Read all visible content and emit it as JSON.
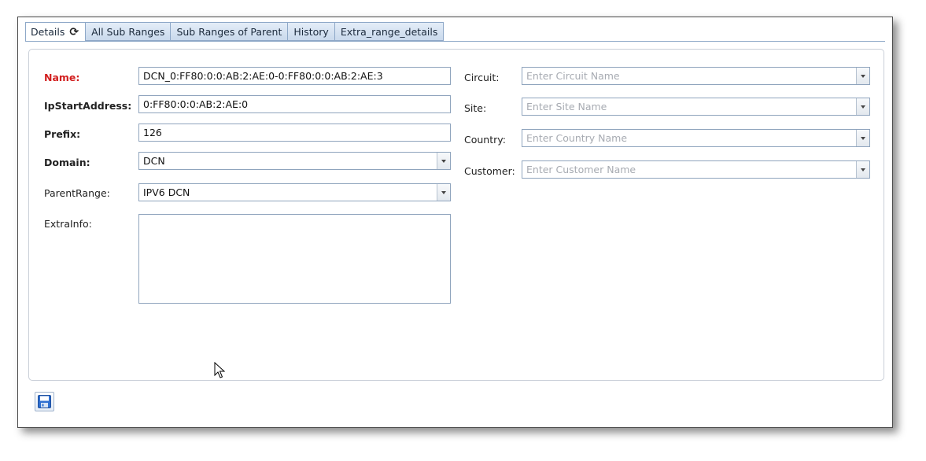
{
  "tabs": [
    {
      "label": "Details",
      "active": true,
      "icon": "refresh-icon"
    },
    {
      "label": "All Sub Ranges"
    },
    {
      "label": "Sub Ranges of Parent"
    },
    {
      "label": "History"
    },
    {
      "label": "Extra_range_details"
    }
  ],
  "form": {
    "name": {
      "label": "Name:",
      "value": "DCN_0:FF80:0:0:AB:2:AE:0-0:FF80:0:0:AB:2:AE:3"
    },
    "ip_start": {
      "label": "IpStartAddress:",
      "value": "0:FF80:0:0:AB:2:AE:0"
    },
    "prefix": {
      "label": "Prefix:",
      "value": "126"
    },
    "domain": {
      "label": "Domain:",
      "value": "DCN"
    },
    "parent_range": {
      "label": "ParentRange:",
      "value": "IPV6 DCN"
    },
    "extra_info": {
      "label": "ExtraInfo:",
      "value": ""
    },
    "circuit": {
      "label": "Circuit:",
      "placeholder": "Enter Circuit Name"
    },
    "site": {
      "label": "Site:",
      "placeholder": "Enter Site Name"
    },
    "country": {
      "label": "Country:",
      "placeholder": "Enter Country Name"
    },
    "customer": {
      "label": "Customer:",
      "placeholder": "Enter Customer Name"
    }
  },
  "toolbar": {
    "save_icon": "floppy-disk-icon"
  },
  "colors": {
    "required_label": "#d21f1f",
    "tab_bg": "#c9d9ec",
    "border": "#8fa4bd"
  }
}
